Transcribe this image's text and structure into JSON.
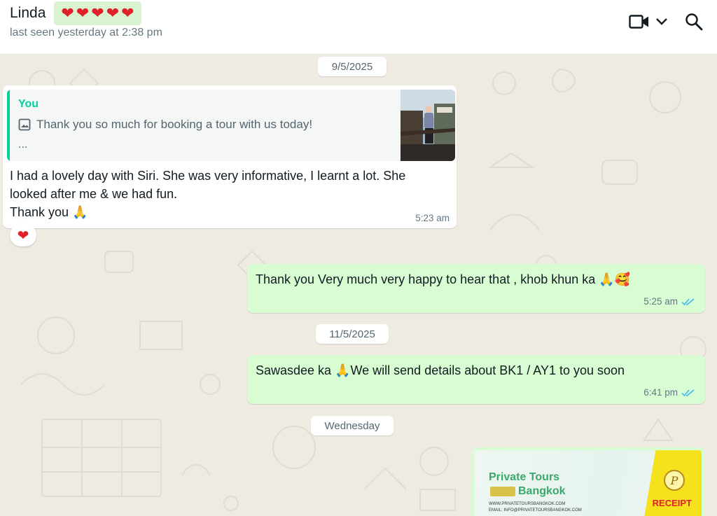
{
  "header": {
    "contact_name": "Linda",
    "hearts": [
      "❤",
      "❤",
      "❤",
      "❤",
      "❤"
    ],
    "last_seen": "last seen yesterday at 2:38 pm",
    "icons": [
      "video-camera-icon",
      "chevron-down-icon",
      "search-icon"
    ]
  },
  "date_chips": [
    "9/5/2025",
    "11/5/2025",
    "Wednesday"
  ],
  "messages": [
    {
      "direction": "incoming",
      "quote": {
        "author": "You",
        "icon": "image-icon",
        "text": "Thank you so much for booking a tour with us today!",
        "ellipsis": "..."
      },
      "text": "I had a lovely day with Siri. She was very informative, I learnt a lot. She\nlooked after me & we had fun.\nThank you 🙏",
      "time": "5:23 am",
      "reaction": "❤"
    },
    {
      "direction": "outgoing",
      "text": "Thank you Very much very happy to hear that , khob khun ka 🙏🥰",
      "time": "5:25 am",
      "status": "read"
    },
    {
      "direction": "outgoing",
      "text": "Sawasdee ka 🙏We will send details about BK1 / AY1 to you soon",
      "time": "6:41 pm",
      "status": "read"
    }
  ],
  "receipt_preview": {
    "brand_line1": "Private Tours",
    "brand_line2": "Bangkok",
    "website": "WWW.PRIVATETOURSBANGKOK.COM",
    "email": "EMAIL: INFO@PRIVATETOURSBANGKOK.COM",
    "label": "RECEIPT",
    "badge_letter": "P"
  },
  "colors": {
    "incoming_bubble": "#ffffff",
    "outgoing_bubble": "#d9fdd3",
    "quote_accent": "#06cf9c",
    "read_ticks": "#53bdeb",
    "chat_background": "#efeae2"
  }
}
